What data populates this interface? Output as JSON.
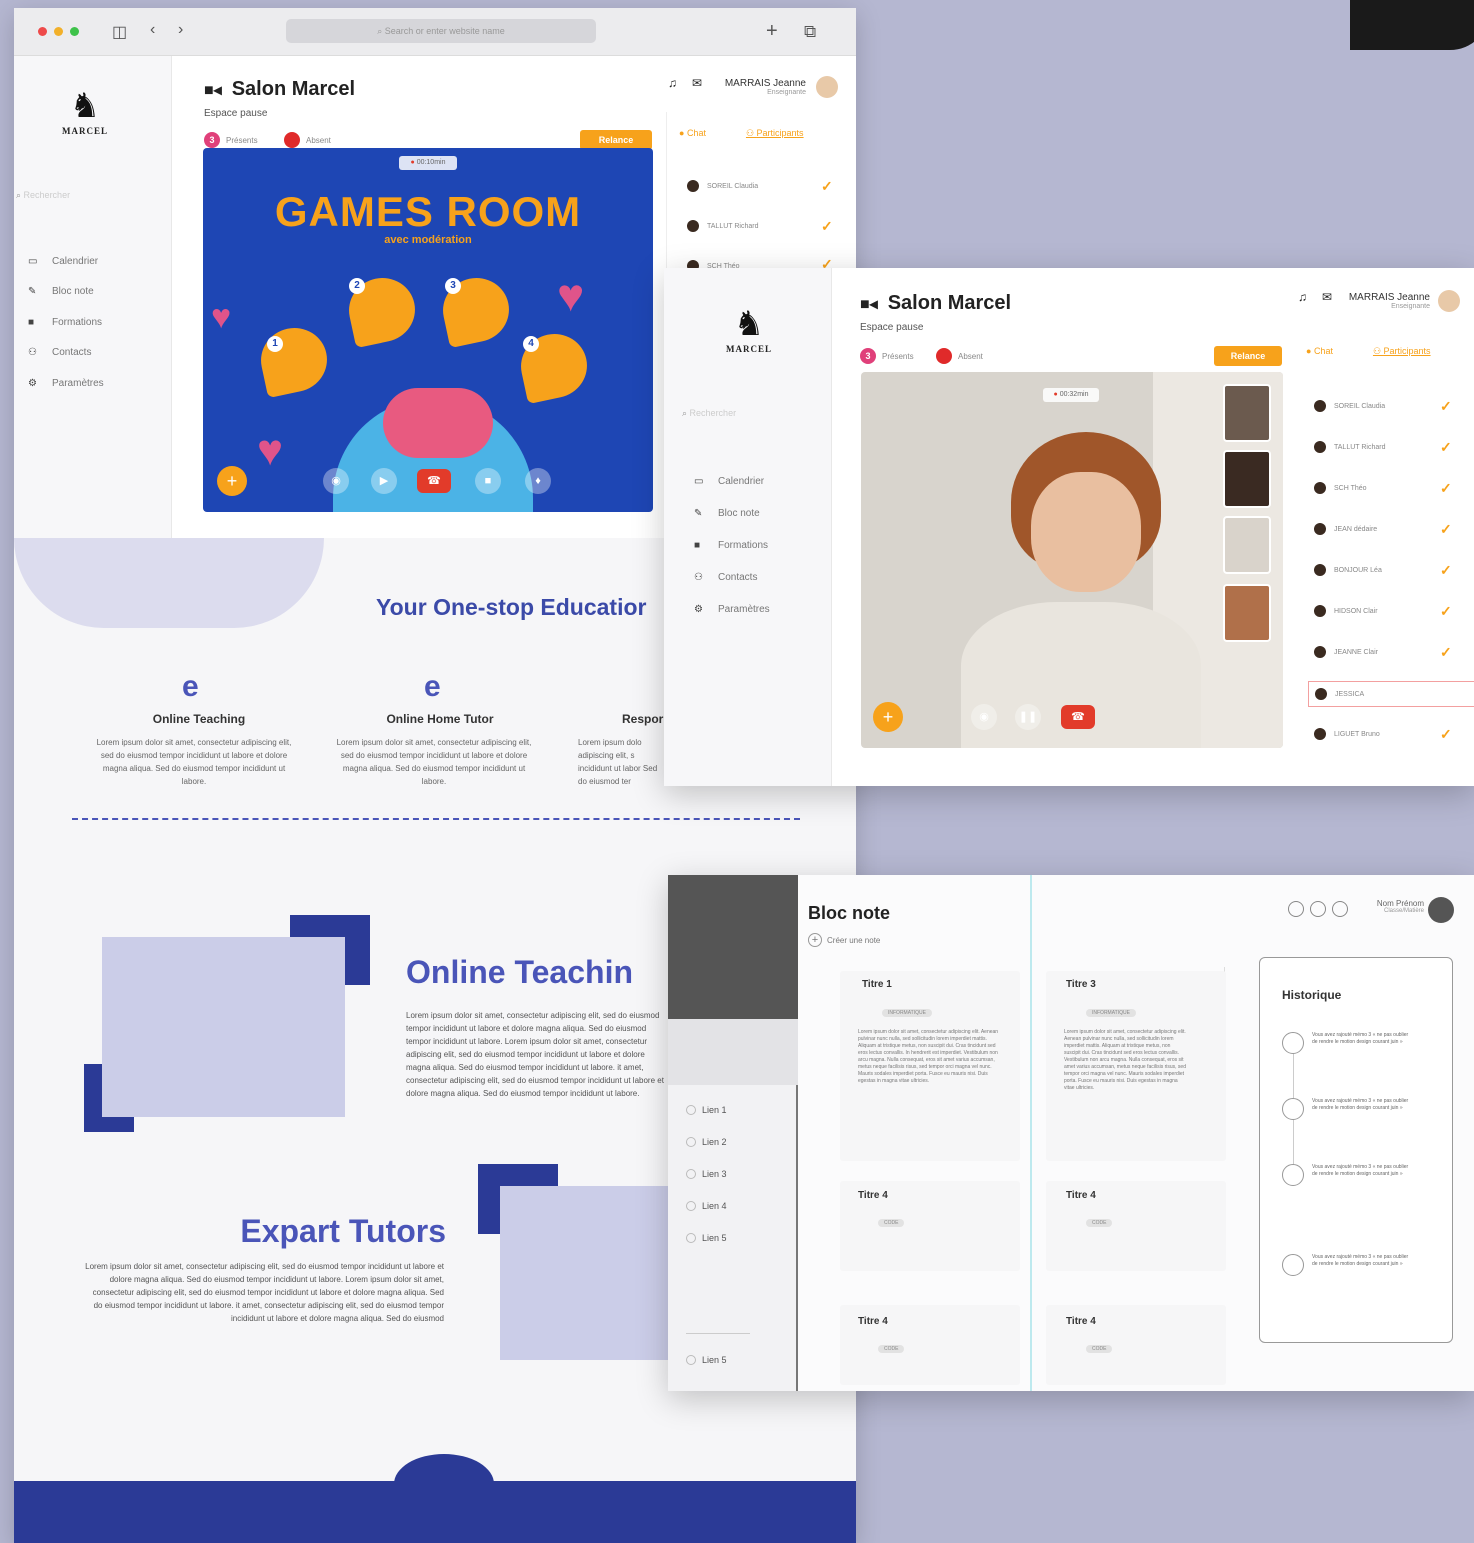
{
  "browser": {
    "url_placeholder": "Search or enter website name",
    "new_tab": "+",
    "tabs_icon": "⧉"
  },
  "app": {
    "logo_text": "MARCEL",
    "search_placeholder": "Rechercher",
    "nav": [
      {
        "icon": "calendar-icon",
        "label": "Calendrier"
      },
      {
        "icon": "pen-icon",
        "label": "Bloc note"
      },
      {
        "icon": "book-icon",
        "label": "Formations"
      },
      {
        "icon": "contacts-icon",
        "label": "Contacts"
      },
      {
        "icon": "settings-icon",
        "label": "Paramètres"
      }
    ],
    "room_title": "Salon Marcel",
    "room_subtitle": "Espace pause",
    "present_count": "3",
    "present_label": "Présents",
    "absent_label": "Absent",
    "relance_label": "Relance",
    "user_name": "MARRAIS Jeanne",
    "user_role_1": "Enseignante",
    "user_role_2": "Enseignante",
    "chat_tab": "Chat",
    "participants_tab": "Participants"
  },
  "games_room": {
    "timer": "00:10min",
    "title": "GAMES ROOM",
    "subtitle": "avec modération",
    "picks": [
      "1",
      "2",
      "3",
      "4"
    ]
  },
  "participants_1": [
    "SOREIL Claudia",
    "TALLUT Richard",
    "SCH Théo"
  ],
  "participants_2": [
    "SOREIL Claudia",
    "TALLUT Richard",
    "SCH Théo",
    "JEAN dédaire",
    "BONJOUR Léa",
    "HIDSON Clair",
    "JEANNE Clair",
    "JESSICA",
    "LIGUET Bruno"
  ],
  "video_timer": "00:32min",
  "landing": {
    "heading": "Your One-stop Educatior",
    "features": [
      {
        "title": "Online Teaching",
        "desc": "Lorem ipsum dolor sit amet, consectetur adipiscing elit, sed do eiusmod tempor incididunt ut labore et dolore magna aliqua. Sed do eiusmod tempor incididunt ut labore."
      },
      {
        "title": "Online Home Tutor",
        "desc": "Lorem ipsum dolor sit amet, consectetur adipiscing elit, sed do eiusmod tempor incididunt ut labore et dolore magna aliqua. Sed do eiusmod tempor incididunt ut labore."
      },
      {
        "title": "Respor",
        "desc": "Lorem ipsum dolo adipiscing elit, s incididunt ut labor Sed do eiusmod ter"
      }
    ],
    "online_teaching_h": "Online Teachin",
    "online_teaching_body": "Lorem ipsum dolor sit amet, consectetur adipiscing elit, sed do eiusmod tempor incididunt ut labore et dolore magna aliqua. Sed do eiusmod tempor incididunt ut labore. Lorem ipsum dolor sit amet, consectetur adipiscing elit, sed do eiusmod tempor incididunt ut labore et dolore magna aliqua. Sed do eiusmod tempor incididunt ut labore. it amet, consectetur adipiscing elit, sed do eiusmod tempor incididunt ut labore et dolore magna aliqua. Sed do eiusmod tempor incididunt ut labore.",
    "expert_h": "Expart Tutors",
    "expert_body": "Lorem ipsum dolor sit amet, consectetur adipiscing elit, sed do eiusmod tempor incididunt ut labore et dolore magna aliqua. Sed do eiusmod tempor incididunt ut labore. Lorem ipsum dolor sit amet, consectetur adipiscing elit, sed do eiusmod tempor incididunt ut labore et dolore magna aliqua. Sed do eiusmod tempor incididunt ut labore. it amet, consectetur adipiscing elit, sed do eiusmod tempor incididunt ut labore et dolore magna aliqua. Sed do eiusmod"
  },
  "bloc_note": {
    "title": "Bloc note",
    "create": "Créer une note",
    "liens": [
      "Lien 1",
      "Lien 2",
      "Lien 3",
      "Lien 4",
      "Lien 5",
      "Lien 5"
    ],
    "user_name": "Nom Prénom",
    "user_role": "Classe/Matière",
    "notes": [
      {
        "title": "Titre 1",
        "tag": "INFORMATIQUE",
        "body": "Lorem ipsum dolor sit amet, consectetur adipiscing elit. Aenean pulvinar nunc nulla, sed sollicitudin lorem imperdiet mattis. Aliquam at tristique metus, non suscipit dui. Cras tincidunt sed eros lectus convallis. In hendrerit est imperdiet. Vestibulum non arcu magna. Nulla consequat, eros sit amet varius accumsan, metus neque facilisis risus, sed tempor orci magna vel nunc. Mauris sodales imperdiet porta. Fusce eu mauris nisi. Duis egestas in magna vitae ultricies."
      },
      {
        "title": "Titre 3",
        "tag": "INFORMATIQUE",
        "body": "Lorem ipsum dolor sit amet, consectetur adipiscing elit. Aenean pulvinar nunc nulla, sed sollicitudin lorem imperdiet mattis. Aliquam at tristique metus, non suscipit dui. Cras tincidunt sed eros lectus convallis. Vestibulum non arcu magna. Nulla consequat, eros sit amet varius accumsan, metus neque facilisis risus, sed tempor orci magna vel nunc. Mauris sodales imperdiet porta. Fusce eu mauris nisi. Duis egestas in magna vitae ultricies."
      },
      {
        "title": "Titre 4",
        "tag": "CODE"
      },
      {
        "title": "Titre 4",
        "tag": "CODE"
      },
      {
        "title": "Titre 4",
        "tag": "CODE"
      },
      {
        "title": "Titre 4",
        "tag": "CODE"
      }
    ],
    "history_title": "Historique",
    "history_item": "Vous avez rajouté mémo 3 « ne pas oublier de rendre le motion design courant juin »"
  }
}
